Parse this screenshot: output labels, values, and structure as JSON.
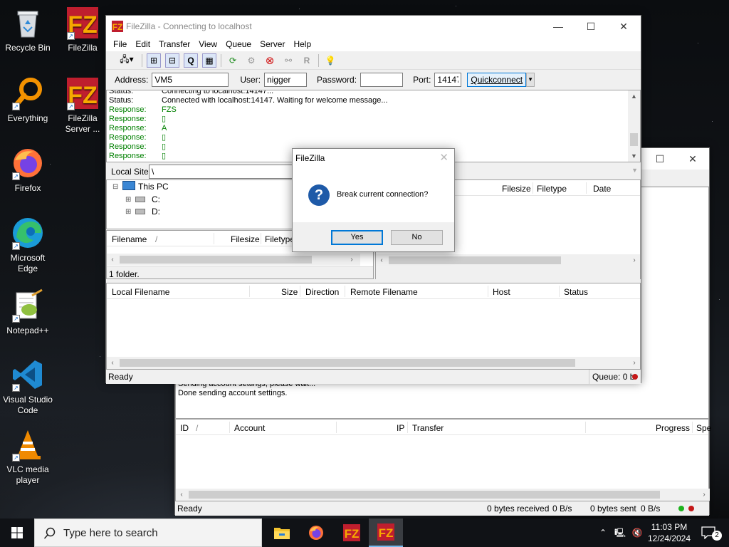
{
  "desktop": {
    "icons": [
      {
        "label": "Recycle Bin"
      },
      {
        "label": "FileZilla"
      },
      {
        "label": "Everything"
      },
      {
        "label": "FileZilla Server ..."
      },
      {
        "label": "Firefox"
      },
      {
        "label": "Microsoft Edge"
      },
      {
        "label": "Notepad++"
      },
      {
        "label": "Visual Studio Code"
      },
      {
        "label": "VLC media player"
      }
    ]
  },
  "server_window": {
    "log": [
      "Sending account settings, please wait...",
      "Done sending account settings."
    ],
    "columns": {
      "id": "ID",
      "account": "Account",
      "ip": "IP",
      "transfer": "Transfer",
      "progress": "Progress",
      "speed": "Spe"
    },
    "status": {
      "ready": "Ready",
      "received": "0 bytes received",
      "recv_rate": "0 B/s",
      "sent": "0 bytes sent",
      "sent_rate": "0 B/s"
    }
  },
  "client_window": {
    "title": "FileZilla - Connecting to localhost",
    "menu": [
      "File",
      "Edit",
      "Transfer",
      "View",
      "Queue",
      "Server",
      "Help"
    ],
    "quickconnect": {
      "address_label": "Address:",
      "address_value": "VM5",
      "user_label": "User:",
      "user_value": "nigger",
      "password_label": "Password:",
      "password_value": "",
      "port_label": "Port:",
      "port_value": "14147",
      "button": "Quickconnect"
    },
    "log": [
      {
        "label": "Status:",
        "text": "Connecting to localhost:14147...",
        "type": "status"
      },
      {
        "label": "Status:",
        "text": "Connected with localhost:14147. Waiting for welcome message...",
        "type": "status"
      },
      {
        "label": "Response:",
        "text": "FZS",
        "type": "response"
      },
      {
        "label": "Response:",
        "text": "▯",
        "type": "response"
      },
      {
        "label": "Response:",
        "text": "A",
        "type": "response"
      },
      {
        "label": "Response:",
        "text": "▯",
        "type": "response"
      },
      {
        "label": "Response:",
        "text": "▯",
        "type": "response"
      },
      {
        "label": "Response:",
        "text": "▯",
        "type": "response"
      }
    ],
    "local_site_label": "Local Site:",
    "local_site_value": "\\",
    "tree": {
      "root": "This PC",
      "drives": [
        "C:",
        "D:"
      ]
    },
    "local_columns": {
      "filename": "Filename",
      "sort": "/",
      "filesize": "Filesize",
      "filetype": "Filetype"
    },
    "remote_columns": {
      "filesize": "Filesize",
      "filetype": "Filetype",
      "date": "Date"
    },
    "local_status": "1 folder.",
    "queue_columns": {
      "local": "Local Filename",
      "size": "Size",
      "direction": "Direction",
      "remote": "Remote Filename",
      "host": "Host",
      "status": "Status"
    },
    "statusbar": {
      "ready": "Ready",
      "queue": "Queue: 0 b"
    }
  },
  "dialog": {
    "title": "FileZilla",
    "message": "Break current connection?",
    "yes": "Yes",
    "no": "No"
  },
  "taskbar": {
    "search_placeholder": "Type here to search",
    "time": "11:03 PM",
    "date": "12/24/2024",
    "notifications": "2"
  },
  "colors": {
    "accent": "#0078d7",
    "response": "#008000",
    "filezilla_red": "#bf1e2e"
  }
}
